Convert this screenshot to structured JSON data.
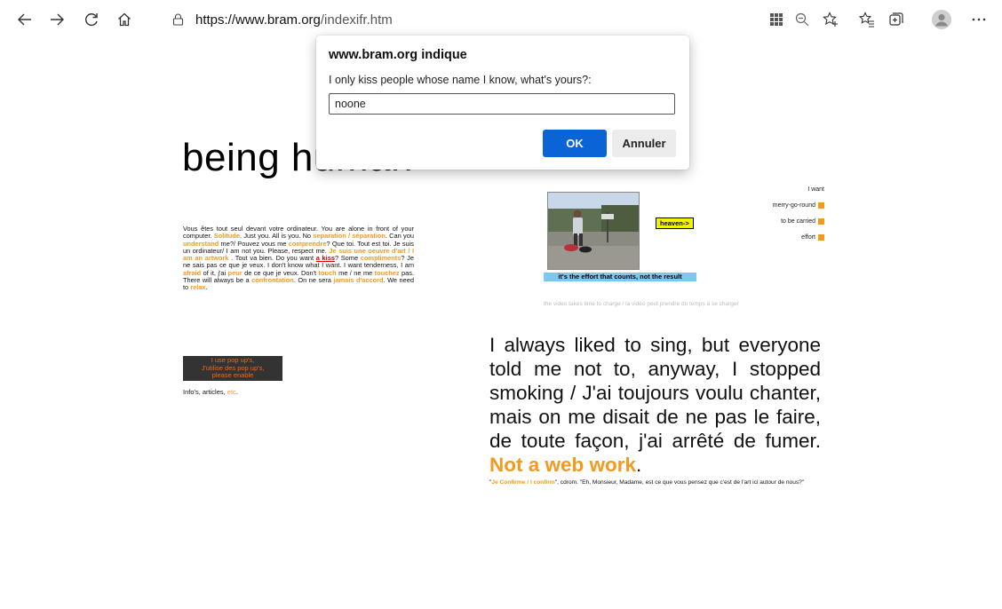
{
  "browser": {
    "url_domain": "https://www.bram.org",
    "url_path": "/indexifr.htm",
    "icons": [
      "back-arrow",
      "forward-arrow",
      "refresh",
      "home",
      "lock",
      "reader-grid",
      "zoom-out",
      "favorite-add",
      "favorites",
      "collections",
      "profile",
      "more"
    ]
  },
  "page": {
    "title": "being human",
    "intro": {
      "t1": "Vous êtes tout seul devant votre ordinateur. You are alone in front of your computer. ",
      "o1": "Solitude",
      "t2": ". Just you. All is you. No ",
      "o2": "separation / séparation",
      "t3": ". Can you ",
      "o3": "understand",
      "t4": " me?/ Pouvez vous me ",
      "o4": "comprendre",
      "t5": "? Que toi. Tout est toi. Je suis un ordinateur/ I am not you. Please, respect me. ",
      "o5": "Je suis une oeuvre d'art / I am an artwork",
      "t6": " . Tout va bien. Do you want ",
      "kiss": "a kiss",
      "t7": "? Some ",
      "o6": "compliments",
      "t8": "? Je ne sais pas ce que je veux. I don't know what I want. I want tenderness, I am ",
      "o7": "afraid",
      "t9": " of it, j'ai ",
      "o8": "peur",
      "t10": " de ce que je veux. Don't ",
      "o9": "touch",
      "t11": " me / ne me ",
      "o10": "touchez",
      "t12": " pas. There will always be a ",
      "o11": "confrontation",
      "t13": ". On ne sera ",
      "o12": "jamais d'accord",
      "t14": ". We need to ",
      "o13": "relax",
      "t15": "."
    },
    "popup_notice": {
      "line1": "I use pop up's,",
      "line2": "J'utilise des pop up's,",
      "line3": "please enable"
    },
    "info": {
      "text": "Info's, articles, ",
      "etc": "etc",
      "end": "."
    },
    "heaven_label": "heaven->",
    "effort_caption": "it's the effort that counts, not the result",
    "video_note": "the video takes time to charge / la vidéo peut prendre du temps à se charger",
    "want_list": {
      "header": "I want",
      "items": [
        "merry-go-round",
        "to be carried",
        "effort"
      ]
    },
    "sing": {
      "text": "I always liked to sing, but everyone told me not to, anyway, I stopped smoking / J'ai toujours voulu chanter, mais on me disait de ne pas le faire, de toute façon, j'ai arrêté de fumer. ",
      "not_web": "Not a web work",
      "end": "."
    },
    "cdrom": {
      "q1": "\"",
      "link": "Je Confirme / I confirm",
      "rest": "\", cdrom. \"Eh, Monsieur, Madame, est ce que vous pensez que c'est de l'art ici autour de nous?\""
    },
    "colors": {
      "accent_orange": "#f39a1e",
      "kiss_red": "#cc0000",
      "ok_blue": "#0a64d6"
    }
  },
  "dialog": {
    "title": "www.bram.org indique",
    "message": "I only kiss people whose name I know, what's yours?:",
    "input_value": "noone",
    "ok_label": "OK",
    "cancel_label": "Annuler"
  }
}
